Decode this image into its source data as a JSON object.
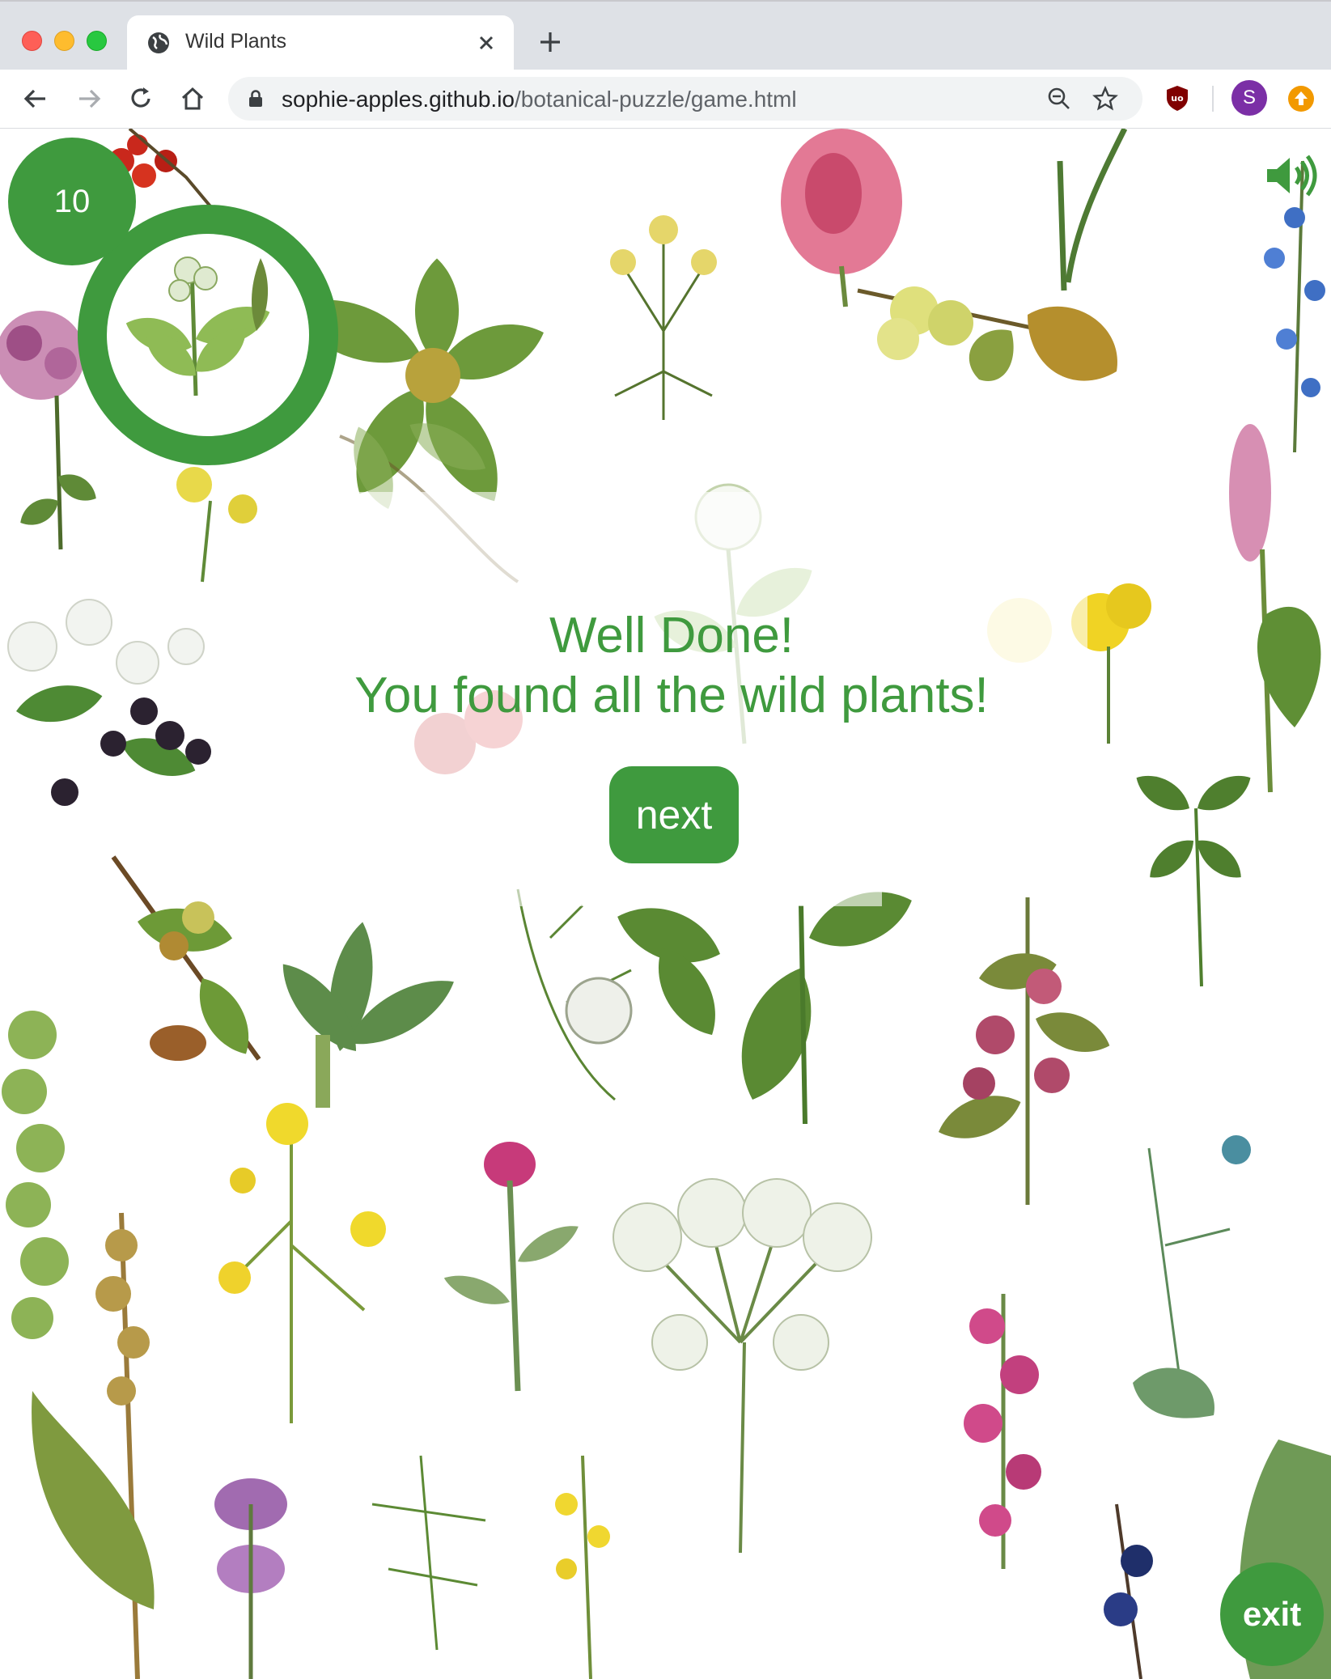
{
  "browser": {
    "tab_title": "Wild Plants",
    "url_host": "sophie-apples.github.io",
    "url_path": "/botanical-puzzle/game.html",
    "profile_initial": "S"
  },
  "game": {
    "score": "10",
    "message_line1": "Well Done!",
    "message_line2": "You found all the wild plants!",
    "next_label": "next",
    "exit_label": "exit",
    "accent_color": "#3f9a3e"
  }
}
